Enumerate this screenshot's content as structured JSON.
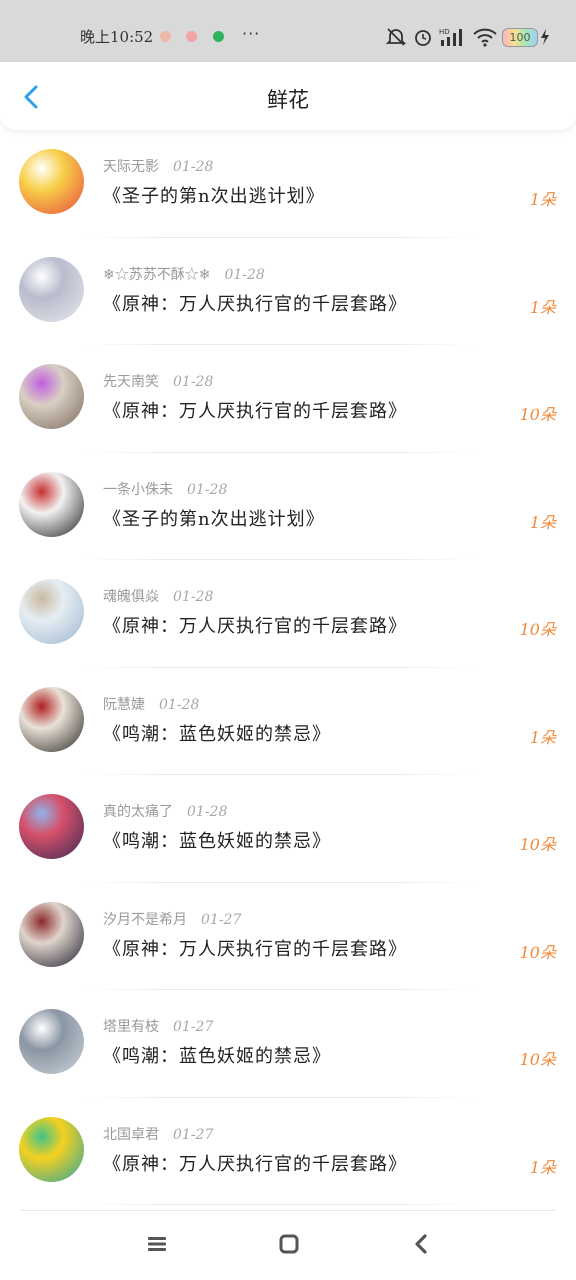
{
  "status_bar": {
    "time": "晚上10:52",
    "more": "···",
    "battery": "100"
  },
  "header": {
    "title": "鲜花"
  },
  "list": [
    {
      "user": "天际无影",
      "date": "01-28",
      "book": "《圣子的第n次出逃计划》",
      "amount": "1朵",
      "avatar_colors": [
        "#e84a3c",
        "#f7d04a",
        "#ffffff"
      ]
    },
    {
      "user": "❄☆苏苏不酥☆❄",
      "date": "01-28",
      "book": "《原神：万人厌执行官的千层套路》",
      "amount": "1朵",
      "avatar_colors": [
        "#e8e8ee",
        "#b9bccc",
        "#ffffff"
      ]
    },
    {
      "user": "先天南笑",
      "date": "01-28",
      "book": "《原神：万人厌执行官的千层套路》",
      "amount": "10朵",
      "avatar_colors": [
        "#7a6a5a",
        "#d9cfc4",
        "#c060e0"
      ]
    },
    {
      "user": "一条小侏未",
      "date": "01-28",
      "book": "《圣子的第n次出逃计划》",
      "amount": "1朵",
      "avatar_colors": [
        "#1f1f1f",
        "#f2f2f2",
        "#c83030"
      ]
    },
    {
      "user": "魂魄俱焱",
      "date": "01-28",
      "book": "《原神：万人厌执行官的千层套路》",
      "amount": "10朵",
      "avatar_colors": [
        "#9cb6cf",
        "#e6eef3",
        "#c9b8a0"
      ]
    },
    {
      "user": "阮慧婕",
      "date": "01-28",
      "book": "《鸣潮：蓝色妖姬的禁忌》",
      "amount": "1朵",
      "avatar_colors": [
        "#2a2622",
        "#e9e2d8",
        "#b02020"
      ]
    },
    {
      "user": "真的太痛了",
      "date": "01-28",
      "book": "《鸣潮：蓝色妖姬的禁忌》",
      "amount": "10朵",
      "avatar_colors": [
        "#3a2a55",
        "#d6506a",
        "#8fb4e8"
      ]
    },
    {
      "user": "汐月不是希月",
      "date": "01-27",
      "book": "《原神：万人厌执行官的千层套路》",
      "amount": "10朵",
      "avatar_colors": [
        "#1e1e2e",
        "#e0d4cc",
        "#8a2a2a"
      ]
    },
    {
      "user": "塔里有枝",
      "date": "01-27",
      "book": "《鸣潮：蓝色妖姬的禁忌》",
      "amount": "10朵",
      "avatar_colors": [
        "#cfd6dc",
        "#8a96a3",
        "#ffffff"
      ]
    },
    {
      "user": "北国卓君",
      "date": "01-27",
      "book": "《原神：万人厌执行官的千层套路》",
      "amount": "1朵",
      "avatar_colors": [
        "#27a6a0",
        "#f5d020",
        "#3fc48a"
      ]
    }
  ],
  "colors": {
    "accent": "#2a9ee8",
    "amount": "#f08a3c",
    "status_bar_bg": "#d9d9d9"
  },
  "icons": {
    "back": "back-arrow-icon",
    "menu": "menu-icon",
    "home": "home-icon",
    "back_nav": "nav-back-icon"
  }
}
